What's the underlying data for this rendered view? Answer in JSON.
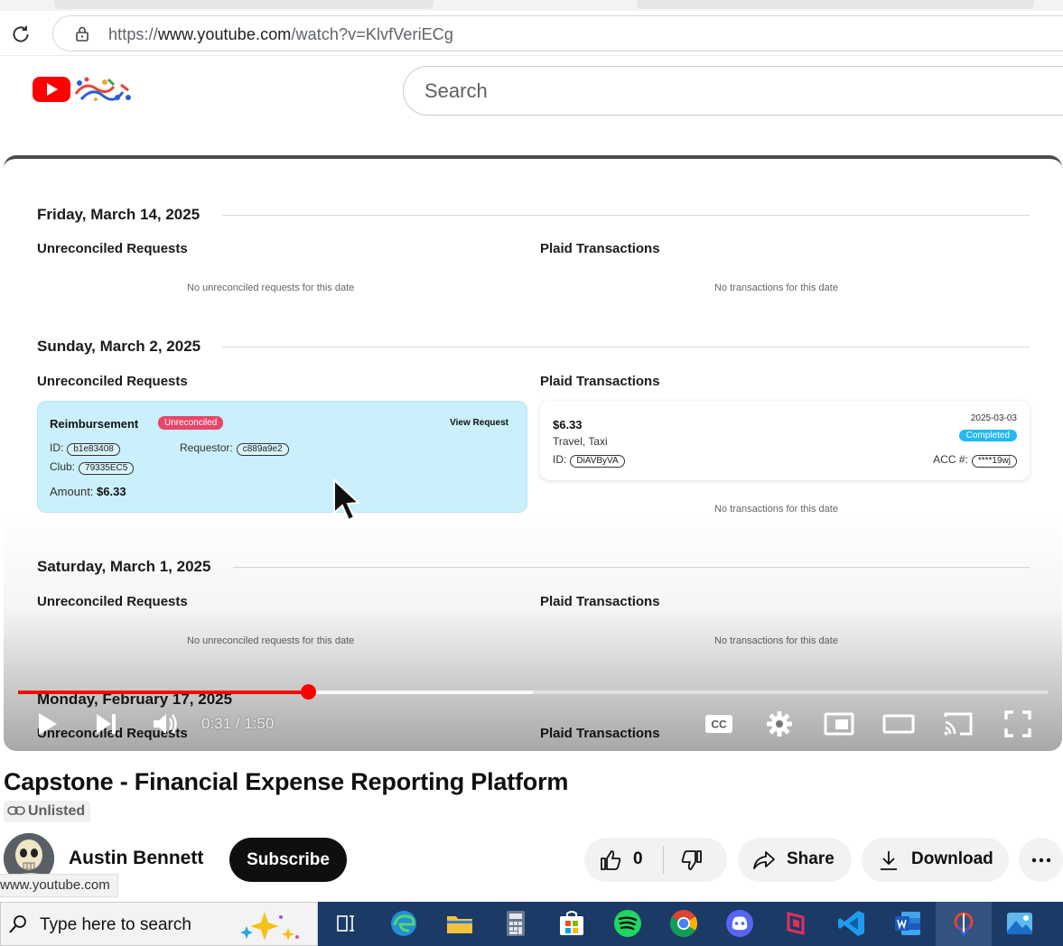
{
  "browser": {
    "url_prefix": "https://",
    "url_domain": "www.youtube.com",
    "url_path": "/watch?v=KlvfVeriECg"
  },
  "header": {
    "search_placeholder": "Search"
  },
  "video_frame": {
    "sections": [
      {
        "date": "Friday, March 14, 2025",
        "left_heading": "Unreconciled Requests",
        "right_heading": "Plaid Transactions",
        "left_empty": "No unreconciled requests for this date",
        "right_empty": "No transactions for this date"
      },
      {
        "date": "Sunday, March 2, 2025",
        "left_heading": "Unreconciled Requests",
        "right_heading": "Plaid Transactions",
        "right_empty": "No transactions for this date"
      },
      {
        "date": "Saturday, March 1, 2025",
        "left_heading": "Unreconciled Requests",
        "right_heading": "Plaid Transactions",
        "left_empty": "No unreconciled requests for this date",
        "right_empty": "No transactions for this date"
      },
      {
        "date": "Monday, February 17, 2025",
        "left_heading": "Unreconciled Requests",
        "right_heading": "Plaid Transactions"
      }
    ],
    "request_card": {
      "title": "Reimbursement",
      "status": "Unreconciled",
      "view_label": "View Request",
      "id_label": "ID:",
      "id_value": "b1e83408",
      "requestor_label": "Requestor:",
      "requestor_value": "c889a9e2",
      "club_label": "Club:",
      "club_value": "79335EC5",
      "amount_label": "Amount:",
      "amount_value": "$6.33"
    },
    "transaction_card": {
      "amount": "$6.33",
      "category": "Travel, Taxi",
      "id_label": "ID:",
      "id_value": "DiAVByVA",
      "date": "2025-03-03",
      "status": "Completed",
      "acc_label": "ACC #:",
      "acc_value": "****19wj"
    }
  },
  "player": {
    "time_current": "0:31",
    "time_total": "1:50",
    "time_display": "0:31 / 1:50",
    "progress_fraction": 0.282,
    "buffered_fraction": 0.5,
    "cc_label": "CC",
    "accent": "#ff0000"
  },
  "video_info": {
    "title": "Capstone - Financial Expense Reporting Platform",
    "visibility": "Unlisted",
    "channel": "Austin Bennett",
    "subscribe_label": "Subscribe",
    "like_count": "0",
    "share_label": "Share",
    "download_label": "Download"
  },
  "status_bar": {
    "hover_url": "www.youtube.com"
  },
  "taskbar": {
    "search_placeholder": "Type here to search",
    "apps": [
      "task-view",
      "edge",
      "file-explorer",
      "calculator",
      "microsoft-store",
      "spotify",
      "chrome",
      "discord",
      "app-red",
      "vscode",
      "word",
      "app-active",
      "photos"
    ]
  }
}
